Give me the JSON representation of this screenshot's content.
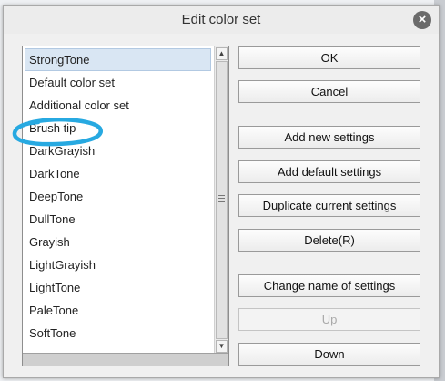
{
  "dialog": {
    "title": "Edit color set",
    "close_icon": "close-icon"
  },
  "list": {
    "items": [
      {
        "label": "StrongTone",
        "selected": true
      },
      {
        "label": "Default color set",
        "selected": false
      },
      {
        "label": "Additional color set",
        "selected": false
      },
      {
        "label": "Brush tip",
        "selected": false
      },
      {
        "label": "DarkGrayish",
        "selected": false
      },
      {
        "label": "DarkTone",
        "selected": false
      },
      {
        "label": "DeepTone",
        "selected": false
      },
      {
        "label": "DullTone",
        "selected": false
      },
      {
        "label": "Grayish",
        "selected": false
      },
      {
        "label": "LightGrayish",
        "selected": false
      },
      {
        "label": "LightTone",
        "selected": false
      },
      {
        "label": "PaleTone",
        "selected": false
      },
      {
        "label": "SoftTone",
        "selected": false
      }
    ],
    "annotation_color": "#27a9e1"
  },
  "buttons": {
    "ok": "OK",
    "cancel": "Cancel",
    "add_new": "Add new settings",
    "add_default": "Add default settings",
    "duplicate": "Duplicate current settings",
    "delete": "Delete(R)",
    "change_name": "Change name of settings",
    "up": "Up",
    "down": "Down"
  }
}
